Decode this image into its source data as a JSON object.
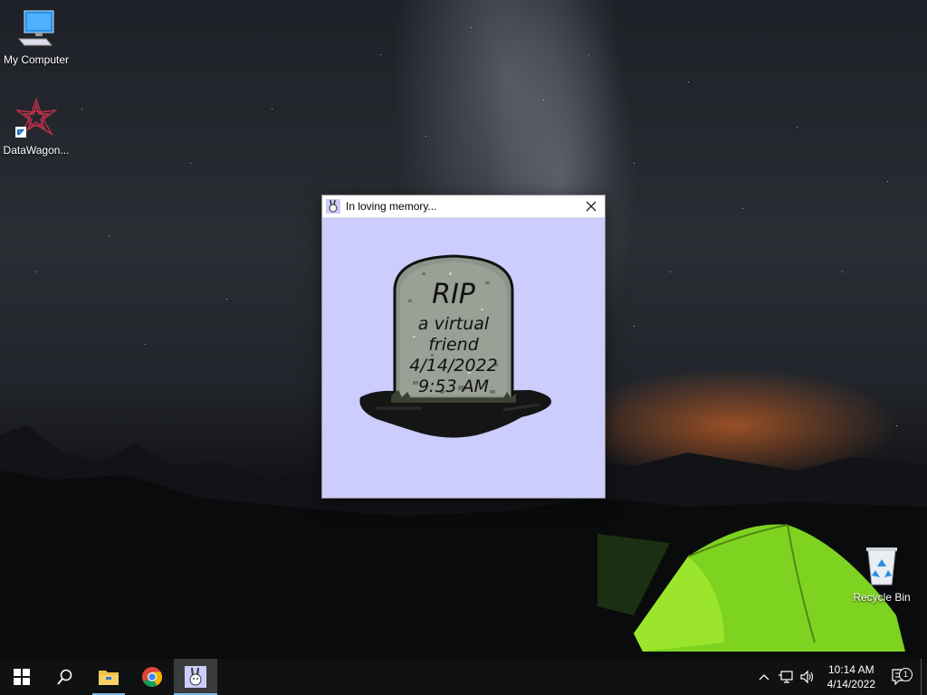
{
  "desktop": {
    "icons": [
      {
        "label": "My Computer",
        "icon": "computer-icon"
      },
      {
        "label": "DataWagon...",
        "icon": "datawagon-shortcut-icon"
      },
      {
        "label": "Recycle Bin",
        "icon": "recycle-bin-icon"
      }
    ]
  },
  "window": {
    "title": "In loving memory...",
    "icon": "rabbit-icon",
    "close_icon": "close-icon",
    "tombstone": {
      "heading": "RIP",
      "lines": [
        "a virtual",
        "friend",
        "4/14/2022",
        "9:53 AM"
      ]
    },
    "background_color": "#ccccfd"
  },
  "taskbar": {
    "items": [
      {
        "name": "start",
        "icon": "windows-logo-icon"
      },
      {
        "name": "search",
        "icon": "search-icon"
      },
      {
        "name": "file-explorer",
        "icon": "folder-icon"
      },
      {
        "name": "chrome",
        "icon": "chrome-icon"
      },
      {
        "name": "rip-app",
        "icon": "rabbit-icon",
        "active": true
      }
    ],
    "tray": {
      "time": "10:14 AM",
      "date": "4/14/2022",
      "notification_count": "1"
    },
    "accent_color": "#76b9ed"
  }
}
